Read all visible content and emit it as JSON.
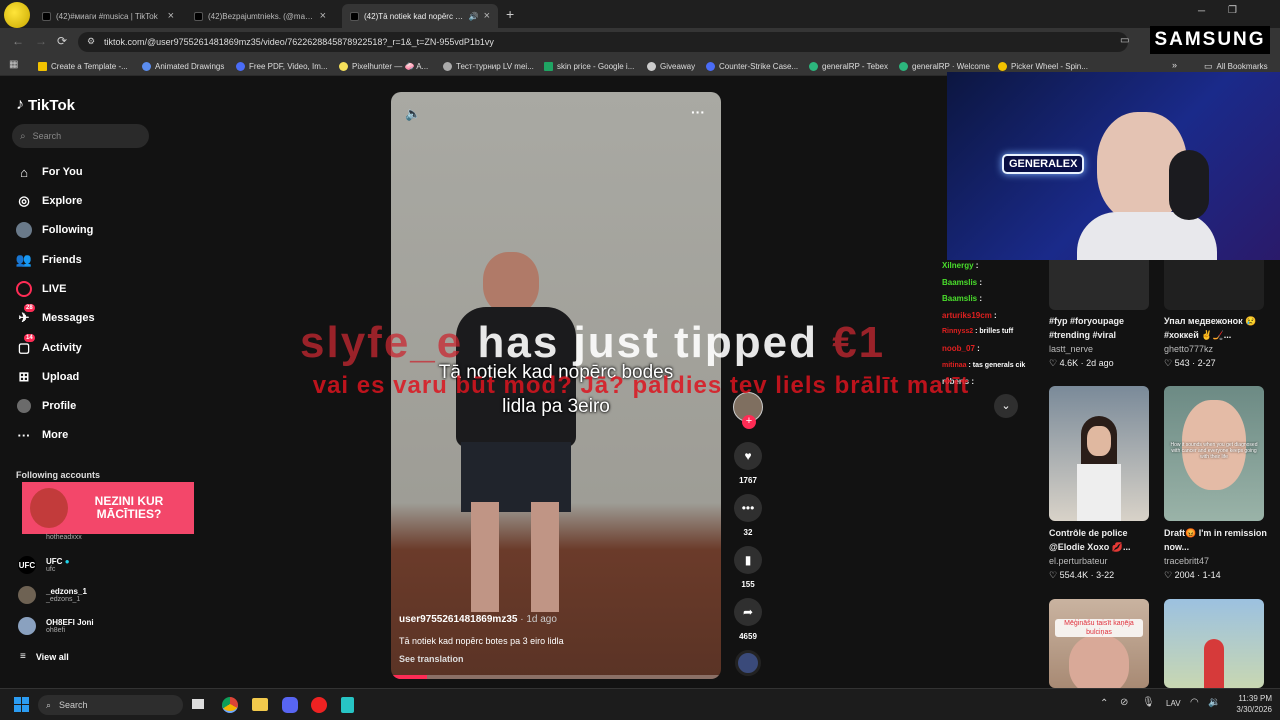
{
  "browser": {
    "tabs": [
      {
        "title": "(42)#миаги #musica | TikTok",
        "active": false
      },
      {
        "title": "(42)Bezpajumtnieks. (@mangu...",
        "active": false
      },
      {
        "title": "(42)Tā notiek kad nopērc b...",
        "active": true
      }
    ],
    "new_tab": "+",
    "url": "tiktok.com/@user9755261481869mz35/video/7622628845878922518?_r=1&_t=ZN-955vdP1b1vy",
    "bookmarks": [
      "Create a Template -...",
      "Animated Drawings",
      "Free PDF, Video, Im...",
      "Pixelhunter — 🧼 A...",
      "Тест-турнир LV mei...",
      "skin price - Google i...",
      "Giveaway",
      "Counter-Strike Case...",
      "generalRP - Tebex",
      "generalRP · Welcome",
      "Picker Wheel - Spin..."
    ],
    "all_bookmarks": "All Bookmarks"
  },
  "overlay": {
    "samsung": "SAMSUNG"
  },
  "sidebar": {
    "logo": "TikTok",
    "search_placeholder": "Search",
    "nav": [
      {
        "label": "For You",
        "icon": "home-icon"
      },
      {
        "label": "Explore",
        "icon": "compass-icon"
      },
      {
        "label": "Following",
        "icon": "following-icon"
      },
      {
        "label": "Friends",
        "icon": "friends-icon"
      },
      {
        "label": "LIVE",
        "icon": "live-icon"
      },
      {
        "label": "Messages",
        "icon": "messages-icon",
        "badge": "28"
      },
      {
        "label": "Activity",
        "icon": "activity-icon",
        "badge": "14"
      },
      {
        "label": "Upload",
        "icon": "upload-icon"
      },
      {
        "label": "Profile",
        "icon": "profile-icon"
      },
      {
        "label": "More",
        "icon": "more-icon"
      }
    ],
    "following_title": "Following accounts",
    "accounts": [
      {
        "name": "",
        "handle": "hotheadxxx"
      },
      {
        "name": "UFC",
        "handle": "ufc"
      },
      {
        "name": "_edzons_1",
        "handle": "_edzons_1"
      },
      {
        "name": "OH8EFI Joni",
        "handle": "oh8efi"
      }
    ],
    "view_all": "View all",
    "ad_text": "NEZINI KUR MĀCĪTIES?"
  },
  "video": {
    "caption_overlay": "Tā notiek kad nopērc bodes lidla pa 3eiro",
    "author": "user9755261481869mz35",
    "time": "· 1d ago",
    "description": "Tā notiek kad nopērc botes pa 3 eiro lidla",
    "see_translation": "See translation",
    "progress": 0.11
  },
  "actions": {
    "likes": "1767",
    "comments": "32",
    "saves": "155",
    "shares": "4659"
  },
  "stream": {
    "tip_name": "slyfe_e",
    "tip_text": "has just tipped",
    "tip_amount": "€1",
    "tip_message": "vai es varu būt mod? Jā? paldies tev liels brālīt matīt",
    "webcam_label": "GENERALEX",
    "chat": [
      {
        "user": "Xilnergy",
        "msg": ""
      },
      {
        "user": "Baamslis",
        "msg": ""
      },
      {
        "user": "Baamslis",
        "msg": ""
      },
      {
        "user": "arturiks19cm",
        "msg": ""
      },
      {
        "user": "Rinnyss2",
        "msg": "brilles tuff"
      },
      {
        "user": "noob_07",
        "msg": ""
      },
      {
        "user": "mitinaa",
        "msg": "tas generals cik"
      },
      {
        "user": "r0berts",
        "msg": ""
      }
    ]
  },
  "related": [
    {
      "caption": "#fyp #foryoupage #trending #viral",
      "author": "lastt_nerve",
      "views": "4.6K",
      "date": "2d ago"
    },
    {
      "caption": "Упал медвежонок 😢 #хоккей ✌️🏒...",
      "author": "ghetto777kz",
      "views": "543",
      "date": "2-27"
    },
    {
      "caption": "Contrôle de police @Elodie Xoxo 💋...",
      "author": "el.perturbateur",
      "views": "554.4K",
      "date": "3-22",
      "thumb_text": ""
    },
    {
      "caption": "Draft😡 I'm in remission now...",
      "author": "tracebritt47",
      "views": "2004",
      "date": "1-14",
      "thumb_text": "How it sounds when you get diagnosed with cancer and everyone keeps going with their life"
    },
    {
      "caption": "",
      "author": "",
      "views": "",
      "date": "",
      "thumb_text": "Mēģināšu taisīt kaņēja bulciņas"
    },
    {
      "caption": "",
      "author": "",
      "views": "",
      "date": ""
    }
  ],
  "taskbar": {
    "search": "Search",
    "lang": "LAV",
    "time": "11:39 PM",
    "date": "3/30/2026"
  }
}
